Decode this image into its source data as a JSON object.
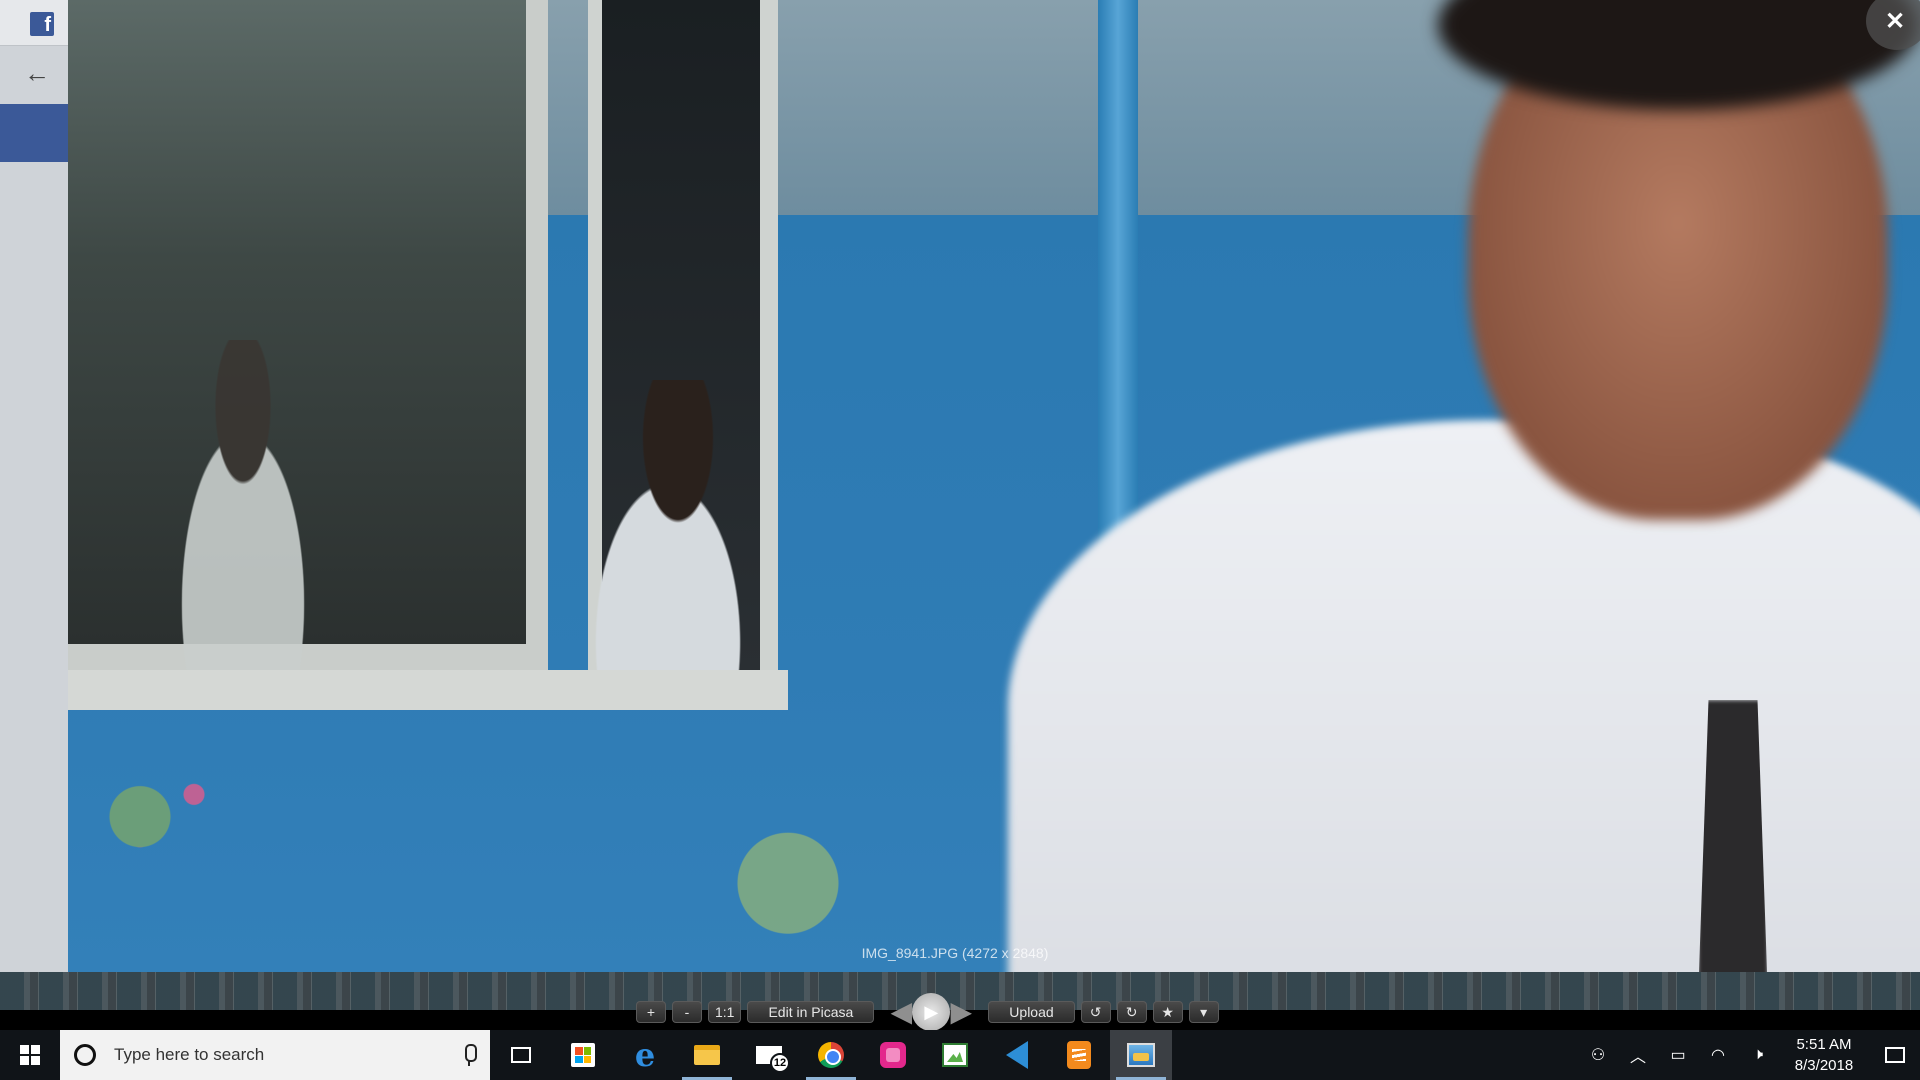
{
  "viewer": {
    "caption": "IMG_8941.JPG (4272 x 2848)",
    "close_label": "✕",
    "toolbar": {
      "zoom_in": "+",
      "zoom_out": "-",
      "actual_size": "1:1",
      "edit": "Edit in Picasa",
      "upload": "Upload",
      "rotate_left": "↺",
      "rotate_right": "↻",
      "star": "★",
      "more": "▾",
      "prev": "◀",
      "next": "▶",
      "play": "▶"
    }
  },
  "browser": {
    "fb_logo": "f",
    "back": "←"
  },
  "taskbar": {
    "search_placeholder": "Type here to search",
    "mail_badge": "12",
    "icons": [
      "windows-start-icon",
      "task-view-icon",
      "store-icon",
      "edge-icon",
      "file-explorer-icon",
      "mail-icon",
      "chrome-icon",
      "pink-app-icon",
      "picasa-edit-icon",
      "vscode-icon",
      "sublime-icon",
      "photo-viewer-icon"
    ],
    "clock_time": "5:51 AM",
    "clock_date": "8/3/2018"
  }
}
